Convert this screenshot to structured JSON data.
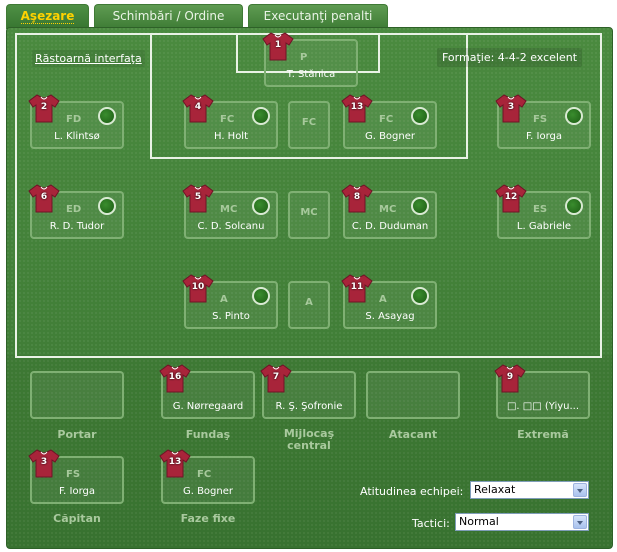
{
  "tabs": [
    {
      "label": "Aşezare",
      "active": true
    },
    {
      "label": "Schimbări / Ordine",
      "active": false
    },
    {
      "label": "Executanţi penalti",
      "active": false
    }
  ],
  "flip_link": "Răstoarnă interfaţa",
  "formation_text": "Formaţie: 4-4-2 excelent",
  "field_slots": [
    {
      "key": "gk",
      "number": "1",
      "position": "P",
      "name": "T. Stănica",
      "has_player": true,
      "status": false
    },
    {
      "key": "rd",
      "number": "2",
      "position": "FD",
      "name": "L. Klintsø",
      "has_player": true,
      "status": true
    },
    {
      "key": "cd1",
      "number": "4",
      "position": "FC",
      "name": "H. Holt",
      "has_player": true,
      "status": true
    },
    {
      "key": "cd_empty",
      "number": "",
      "position": "FC",
      "name": "",
      "has_player": false,
      "status": false
    },
    {
      "key": "cd2",
      "number": "13",
      "position": "FC",
      "name": "G. Bogner",
      "has_player": true,
      "status": true
    },
    {
      "key": "ld",
      "number": "3",
      "position": "FS",
      "name": "F. Iorga",
      "has_player": true,
      "status": true
    },
    {
      "key": "rm",
      "number": "6",
      "position": "ED",
      "name": "R. D. Tudor",
      "has_player": true,
      "status": true
    },
    {
      "key": "cm1",
      "number": "5",
      "position": "MC",
      "name": "C. D. Solcanu",
      "has_player": true,
      "status": true
    },
    {
      "key": "cm_empty",
      "number": "",
      "position": "MC",
      "name": "",
      "has_player": false,
      "status": false
    },
    {
      "key": "cm2",
      "number": "8",
      "position": "MC",
      "name": "C. D. Duduman",
      "has_player": true,
      "status": true
    },
    {
      "key": "lm",
      "number": "12",
      "position": "ES",
      "name": "L. Gabriele",
      "has_player": true,
      "status": true
    },
    {
      "key": "fw1",
      "number": "10",
      "position": "A",
      "name": "S. Pinto",
      "has_player": true,
      "status": true
    },
    {
      "key": "fw_empty",
      "number": "",
      "position": "A",
      "name": "",
      "has_player": false,
      "status": false
    },
    {
      "key": "fw2",
      "number": "11",
      "position": "A",
      "name": "S. Asayag",
      "has_player": true,
      "status": true
    }
  ],
  "bench_slots": [
    {
      "key": "sub_gk",
      "label": "Portar",
      "number": "",
      "name": "",
      "has_player": false
    },
    {
      "key": "sub_def",
      "label": "Fundaş",
      "number": "16",
      "name": "G. Nørregaard",
      "has_player": true
    },
    {
      "key": "sub_mid",
      "label": "Mijlocaş central",
      "number": "7",
      "name": "R. Ş. Şofronie",
      "has_player": true
    },
    {
      "key": "sub_att",
      "label": "Atacant",
      "number": "",
      "name": "",
      "has_player": false
    },
    {
      "key": "sub_ext",
      "label": "Extremă",
      "number": "9",
      "name": "□. □□ (Yiyu...",
      "has_player": true
    }
  ],
  "captain": {
    "label": "Căpitan",
    "number": "3",
    "position": "FS",
    "name": "F. Iorga"
  },
  "set_pieces": {
    "label": "Faze fixe",
    "number": "13",
    "position": "FC",
    "name": "G. Bogner"
  },
  "attitude": {
    "label": "Atitudinea echipei:",
    "value": "Relaxat"
  },
  "tactics": {
    "label": "Tactici:",
    "value": "Normal"
  },
  "colors": {
    "shirt": "#a8243a",
    "shirt_dark": "#6e1426",
    "grass": "#3f7d35",
    "tab_active_text": "#ffd200"
  }
}
